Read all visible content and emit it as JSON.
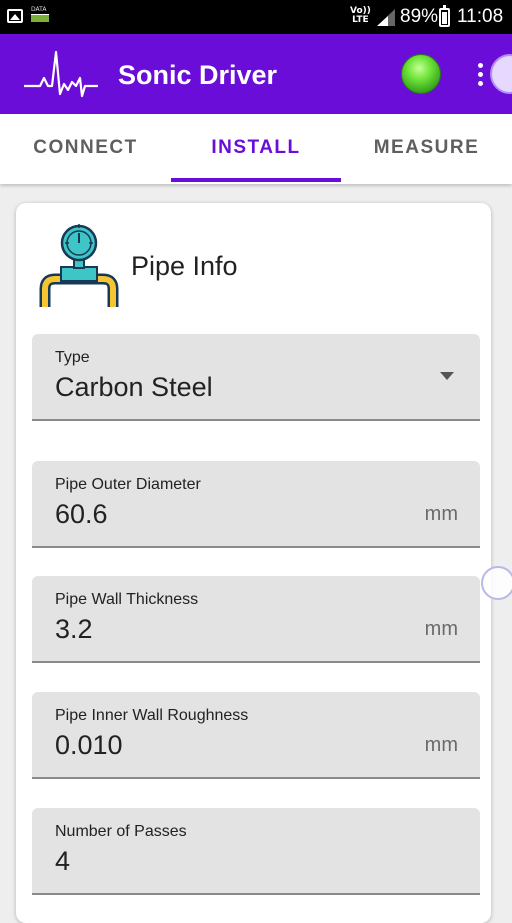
{
  "status_bar": {
    "data_label": "DATA",
    "volte_top": "Vo))",
    "volte_bottom": "LTE",
    "battery_percent": "89%",
    "time": "11:08"
  },
  "app_bar": {
    "title": "Sonic Driver",
    "connection_status_color": "#4fcf26",
    "accent_color": "#6a0dd8"
  },
  "tabs": [
    {
      "label": "CONNECT",
      "selected": false
    },
    {
      "label": "INSTALL",
      "selected": true
    },
    {
      "label": "MEASURE",
      "selected": false
    }
  ],
  "card": {
    "icon": "pipe-gauge-icon",
    "title": "Pipe Info",
    "fields": [
      {
        "label": "Type",
        "value": "Carbon Steel",
        "unit": "",
        "type": "dropdown"
      },
      {
        "label": "Pipe Outer Diameter",
        "value": "60.6",
        "unit": "mm",
        "type": "number"
      },
      {
        "label": "Pipe Wall Thickness",
        "value": "3.2",
        "unit": "mm",
        "type": "number"
      },
      {
        "label": "Pipe Inner Wall Roughness",
        "value": "0.010",
        "unit": "mm",
        "type": "number"
      },
      {
        "label": "Number of Passes",
        "value": "4",
        "unit": "",
        "type": "number"
      }
    ]
  }
}
